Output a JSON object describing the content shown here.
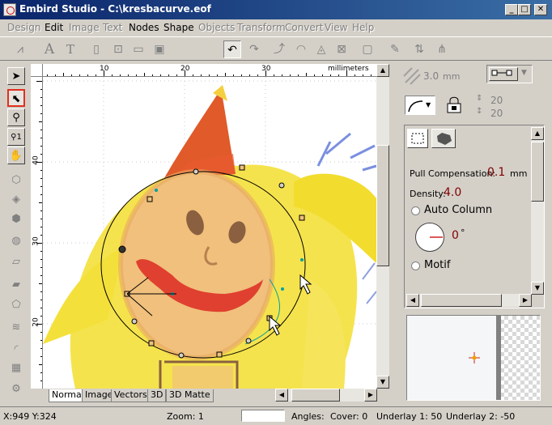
{
  "window": {
    "title": "Embird Studio - C:\\kresbacurve.eof",
    "minimize": "_",
    "maximize": "□",
    "close": "✕"
  },
  "menu": [
    {
      "label": "Design",
      "enabled": false
    },
    {
      "label": "Edit",
      "enabled": true
    },
    {
      "label": "Image",
      "enabled": false
    },
    {
      "label": "Text",
      "enabled": false
    },
    {
      "label": "Nodes",
      "enabled": true
    },
    {
      "label": "Shape",
      "enabled": true
    },
    {
      "label": "Objects",
      "enabled": false
    },
    {
      "label": "Transform",
      "enabled": false
    },
    {
      "label": "Convert",
      "enabled": false
    },
    {
      "label": "View",
      "enabled": false
    },
    {
      "label": "Help",
      "enabled": false
    }
  ],
  "toolbar_icons": [
    "zigzag-icon",
    "text-A-icon",
    "text-effect-icon",
    "new-file-icon",
    "open-file-icon",
    "open-folder-icon",
    "save-icon",
    "undo-icon",
    "redo-icon",
    "curve-icon",
    "gauge-icon",
    "reshape-icon",
    "node-icon",
    "sewing-icon",
    "needle-icon",
    "frame-icon",
    "brush-icon",
    "stitch-icon",
    "stitch2-icon"
  ],
  "ruler": {
    "unit": "millimeters",
    "h_ticks": [
      "10",
      "20",
      "30"
    ],
    "v_ticks": [
      "40",
      "30",
      "20"
    ]
  },
  "tabs": [
    "Normal",
    "Image",
    "Vectors",
    "3D",
    "3D Matte"
  ],
  "active_tab": "Normal",
  "status": {
    "coords": "X:949  Y:324",
    "zoom": "Zoom: 1",
    "angles": "Angles:",
    "cover": "Cover: 0",
    "underlay1": "Underlay 1: 50",
    "underlay2": "Underlay 2: -50"
  },
  "panel": {
    "spacing_value": "3.0",
    "spacing_unit": "mm",
    "spin_top": "20",
    "spin_bottom": "20",
    "pull_label": "Pull Compensation:",
    "pull_value": "0.1",
    "pull_unit": "mm",
    "density_label": "Density:",
    "density_value": "4.0",
    "auto_column": "Auto Column",
    "angle_value": "0",
    "angle_unit": "°",
    "motif": "Motif"
  },
  "colors": {
    "accent_red": "#800000",
    "selection_red": "#e03020",
    "titlebar": "#0a246a"
  }
}
